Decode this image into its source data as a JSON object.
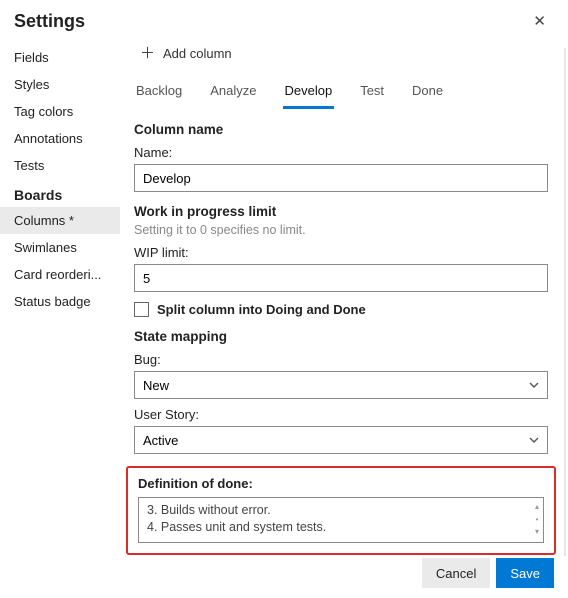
{
  "header": {
    "title": "Settings"
  },
  "sidebar": {
    "group1": [
      "Fields",
      "Styles",
      "Tag colors",
      "Annotations",
      "Tests"
    ],
    "group2_title": "Boards",
    "group2": [
      "Columns *",
      "Swimlanes",
      "Card reorderi...",
      "Status badge"
    ],
    "selected": "Columns *"
  },
  "toolbar": {
    "add_column": "Add column"
  },
  "tabs": {
    "items": [
      "Backlog",
      "Analyze",
      "Develop",
      "Test",
      "Done"
    ],
    "active": "Develop"
  },
  "column_name": {
    "heading": "Column name",
    "label": "Name:",
    "value": "Develop"
  },
  "wip": {
    "heading": "Work in progress limit",
    "sub": "Setting it to 0 specifies no limit.",
    "label": "WIP limit:",
    "value": "5",
    "split_label": "Split column into Doing and Done",
    "split_checked": false
  },
  "state_mapping": {
    "heading": "State mapping",
    "bug_label": "Bug:",
    "bug_value": "New",
    "story_label": "User Story:",
    "story_value": "Active"
  },
  "dod": {
    "heading": "Definition of done:",
    "lines": [
      "3. Builds without error.",
      "4. Passes unit and system tests."
    ]
  },
  "footer": {
    "cancel": "Cancel",
    "save": "Save"
  }
}
